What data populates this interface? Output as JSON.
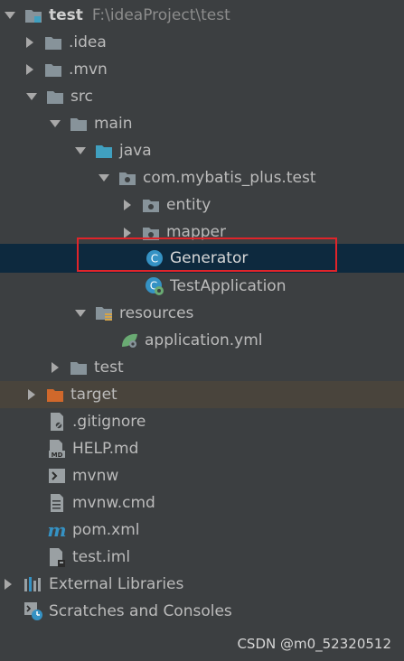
{
  "tree": {
    "root": {
      "label": "test",
      "path": "F:\\ideaProject\\test"
    },
    "idea": "idea",
    "mvn": "mvn",
    "src": "src",
    "main": "main",
    "java": "java",
    "package": "com.mybatis_plus.test",
    "entity": "entity",
    "mapper": "mapper",
    "generator": "Generator",
    "test_application": "TestApplication",
    "resources": "resources",
    "application_yml": "application.yml",
    "test_dir": "test",
    "target": "target",
    "gitignore": ".gitignore",
    "help_md": "HELP.md",
    "mvnw": "mvnw",
    "mvnw_cmd": "mvnw.cmd",
    "pom_xml": "pom.xml",
    "test_iml": "test.iml",
    "external_libraries": "External Libraries",
    "scratches": "Scratches and Consoles"
  },
  "watermark": "CSDN @m0_52320512",
  "colors": {
    "background": "#3c3f41",
    "selected": "#0d293e",
    "excluded": "#49443c",
    "highlight_box": "#e0242a",
    "folder": "#87939a",
    "source_folder": "#40a0c0",
    "excluded_folder": "#d0682b"
  }
}
